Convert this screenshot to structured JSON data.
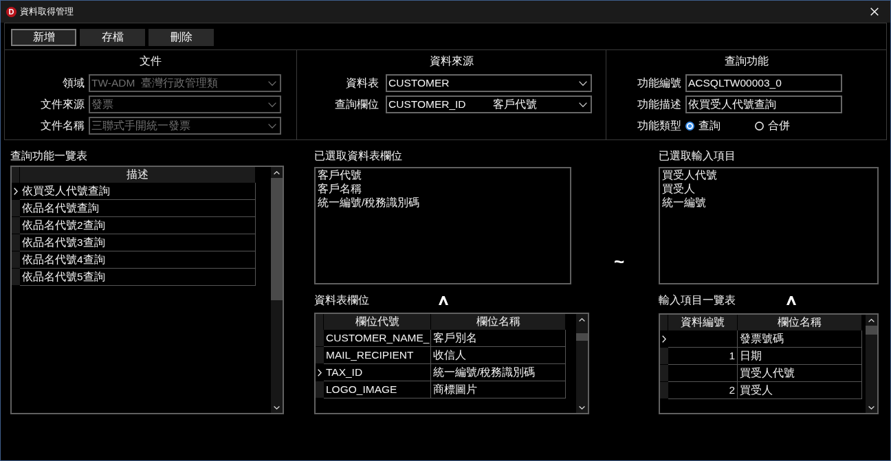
{
  "window": {
    "logo": "D",
    "title": "資料取得管理"
  },
  "toolbar": {
    "buttons": [
      {
        "label": "新增",
        "focused": true
      },
      {
        "label": "存檔",
        "focused": false
      },
      {
        "label": "刪除",
        "focused": false
      }
    ]
  },
  "groups": [
    {
      "title": "文件",
      "fields": [
        {
          "kind": "dropdown",
          "label": "領域",
          "value": "TW-ADM  臺灣行政管理類",
          "disabled": true
        },
        {
          "kind": "dropdown",
          "label": "文件來源",
          "value": "發票",
          "disabled": true
        },
        {
          "kind": "dropdown",
          "label": "文件名稱",
          "value": "三聯式手開統一發票",
          "disabled": true
        }
      ]
    },
    {
      "title": "資料來源",
      "fields": [
        {
          "kind": "dropdown",
          "label": "資料表",
          "value": "CUSTOMER",
          "disabled": false
        },
        {
          "kind": "dropdown",
          "label": "查詢欄位",
          "value": "CUSTOMER_ID",
          "detail": "客戶代號",
          "disabled": false
        }
      ]
    },
    {
      "title": "查詢功能",
      "fields": [
        {
          "kind": "text",
          "label": "功能編號",
          "value": "ACSQLTW00003_0"
        },
        {
          "kind": "text",
          "label": "功能描述",
          "value": "依買受人代號查詢"
        },
        {
          "kind": "radio",
          "label": "功能類型",
          "options": [
            {
              "label": "查詢",
              "selected": true
            },
            {
              "label": "合併",
              "selected": false
            }
          ]
        }
      ]
    }
  ],
  "query_list": {
    "title": "查詢功能一覽表",
    "columns": [
      "描述"
    ],
    "rows": [
      {
        "description": "依買受人代號查詢",
        "selected": true
      },
      {
        "description": "依品名代號查詢",
        "selected": false
      },
      {
        "description": "依品名代號2查詢",
        "selected": false
      },
      {
        "description": "依品名代號3查詢",
        "selected": false
      },
      {
        "description": "依品名代號4查詢",
        "selected": false
      },
      {
        "description": "依品名代號5查詢",
        "selected": false
      }
    ]
  },
  "selected_fields": {
    "title": "已選取資料表欄位",
    "items": [
      "客戶代號",
      "客戶名稱",
      "統一編號/稅務識別碼"
    ]
  },
  "table_fields": {
    "title": "資料表欄位",
    "columns": [
      "欄位代號",
      "欄位名稱"
    ],
    "rows": [
      {
        "code": "CUSTOMER_NAME_",
        "name": "客戶別名",
        "selected": false
      },
      {
        "code": "MAIL_RECIPIENT",
        "name": "收信人",
        "selected": false
      },
      {
        "code": "TAX_ID",
        "name": "統一編號/稅務識別碼",
        "selected": true
      },
      {
        "code": "LOGO_IMAGE",
        "name": "商標圖片",
        "selected": false
      }
    ]
  },
  "range_mark": "~",
  "selected_inputs": {
    "title": "已選取輸入項目",
    "items": [
      "買受人代號",
      "買受人",
      "統一編號"
    ]
  },
  "input_items": {
    "title": "輸入項目一覽表",
    "columns": [
      "資料編號",
      "欄位名稱"
    ],
    "rows": [
      {
        "name": "發票號碼",
        "selected": true
      },
      {
        "number": "1",
        "name": "日期",
        "selected": false
      },
      {
        "name": "買受人代號",
        "selected": false
      },
      {
        "number": "2",
        "name": "買受人",
        "selected": false
      }
    ]
  }
}
